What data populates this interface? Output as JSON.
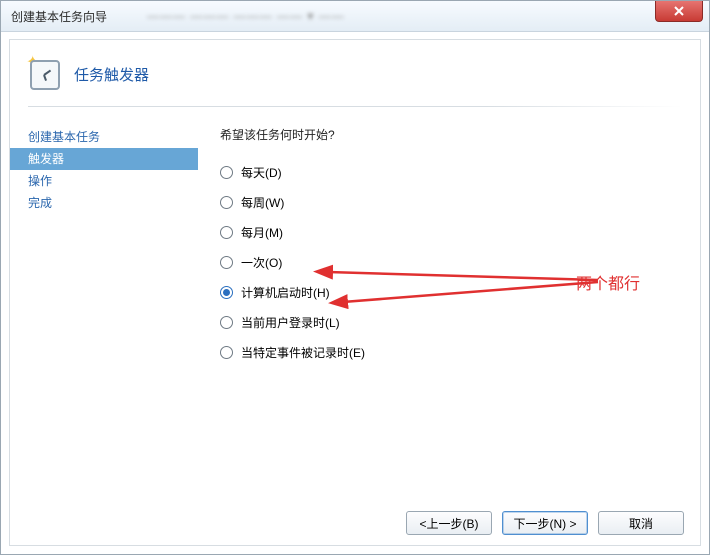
{
  "window": {
    "title": "创建基本任务向导",
    "blurred_background_text": "———  ———  ———        ——    ▾  ——"
  },
  "header": {
    "title": "任务触发器"
  },
  "sidebar": {
    "items": [
      {
        "label": "创建基本任务",
        "selected": false
      },
      {
        "label": "触发器",
        "selected": true
      },
      {
        "label": "操作",
        "selected": false
      },
      {
        "label": "完成",
        "selected": false
      }
    ]
  },
  "main": {
    "question": "希望该任务何时开始?",
    "options": [
      {
        "label": "每天(D)",
        "checked": false
      },
      {
        "label": "每周(W)",
        "checked": false
      },
      {
        "label": "每月(M)",
        "checked": false
      },
      {
        "label": "一次(O)",
        "checked": false
      },
      {
        "label": "计算机启动时(H)",
        "checked": true
      },
      {
        "label": "当前用户登录时(L)",
        "checked": false
      },
      {
        "label": "当特定事件被记录时(E)",
        "checked": false
      }
    ]
  },
  "annotation": {
    "text": "两个都行",
    "color": "#e03030"
  },
  "footer": {
    "back": "<上一步(B)",
    "next": "下一步(N) >",
    "cancel": "取消"
  }
}
